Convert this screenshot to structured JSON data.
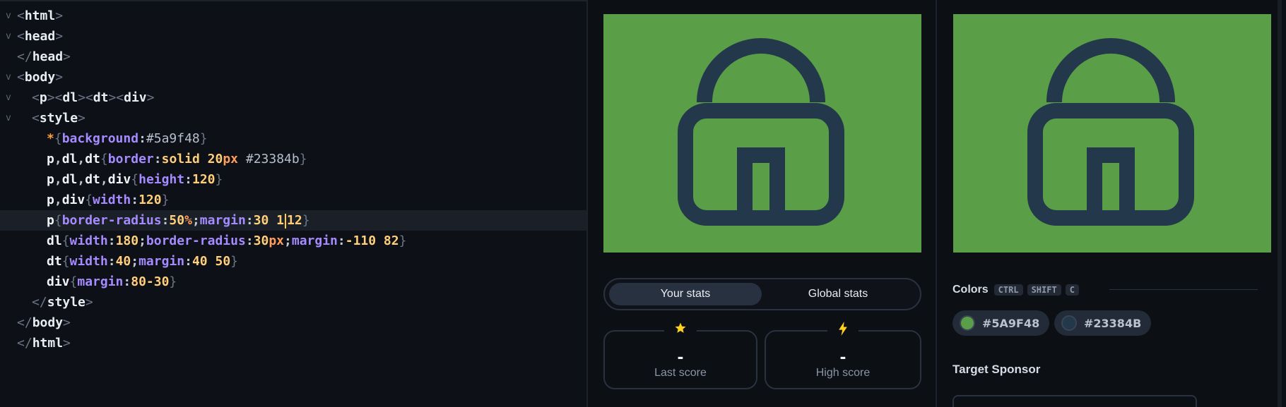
{
  "editor": {
    "lines": [
      {
        "fold": "v",
        "indent": 0,
        "tokens": [
          [
            "br",
            "<"
          ],
          [
            "tag",
            "html"
          ],
          [
            "br",
            ">"
          ]
        ]
      },
      {
        "fold": "v",
        "indent": 0,
        "tokens": [
          [
            "br",
            "<"
          ],
          [
            "tag",
            "head"
          ],
          [
            "br",
            ">"
          ]
        ]
      },
      {
        "fold": "",
        "indent": 0,
        "tokens": [
          [
            "br",
            "</"
          ],
          [
            "tag",
            "head"
          ],
          [
            "br",
            ">"
          ]
        ]
      },
      {
        "fold": "v",
        "indent": 0,
        "tokens": [
          [
            "br",
            "<"
          ],
          [
            "tag",
            "body"
          ],
          [
            "br",
            ">"
          ]
        ]
      },
      {
        "fold": "v",
        "indent": 1,
        "tokens": [
          [
            "br",
            "<"
          ],
          [
            "tag",
            "p"
          ],
          [
            "br",
            "><"
          ],
          [
            "tag",
            "dl"
          ],
          [
            "br",
            "><"
          ],
          [
            "tag",
            "dt"
          ],
          [
            "br",
            "><"
          ],
          [
            "tag",
            "div"
          ],
          [
            "br",
            ">"
          ]
        ]
      },
      {
        "fold": "v",
        "indent": 1,
        "tokens": [
          [
            "br",
            "<"
          ],
          [
            "tag",
            "style"
          ],
          [
            "br",
            ">"
          ]
        ]
      },
      {
        "fold": "",
        "indent": 2,
        "tokens": [
          [
            "star",
            "*"
          ],
          [
            "br",
            "{"
          ],
          [
            "prop",
            "background"
          ],
          [
            "punc",
            ":"
          ],
          [
            "hex",
            "#5a9f48"
          ],
          [
            "br",
            "}"
          ]
        ]
      },
      {
        "fold": "",
        "indent": 2,
        "tokens": [
          [
            "sel",
            "p"
          ],
          [
            "punc",
            ","
          ],
          [
            "sel",
            "dl"
          ],
          [
            "punc",
            ","
          ],
          [
            "sel",
            "dt"
          ],
          [
            "br",
            "{"
          ],
          [
            "prop",
            "border"
          ],
          [
            "punc",
            ":"
          ],
          [
            "kw",
            "solid "
          ],
          [
            "num",
            "20"
          ],
          [
            "unit",
            "px"
          ],
          [
            "hex",
            " #23384b"
          ],
          [
            "br",
            "}"
          ]
        ]
      },
      {
        "fold": "",
        "indent": 2,
        "tokens": [
          [
            "sel",
            "p"
          ],
          [
            "punc",
            ","
          ],
          [
            "sel",
            "dl"
          ],
          [
            "punc",
            ","
          ],
          [
            "sel",
            "dt"
          ],
          [
            "punc",
            ","
          ],
          [
            "sel",
            "div"
          ],
          [
            "br",
            "{"
          ],
          [
            "prop",
            "height"
          ],
          [
            "punc",
            ":"
          ],
          [
            "num",
            "120"
          ],
          [
            "br",
            "}"
          ]
        ]
      },
      {
        "fold": "",
        "indent": 2,
        "tokens": [
          [
            "sel",
            "p"
          ],
          [
            "punc",
            ","
          ],
          [
            "sel",
            "div"
          ],
          [
            "br",
            "{"
          ],
          [
            "prop",
            "width"
          ],
          [
            "punc",
            ":"
          ],
          [
            "num",
            "120"
          ],
          [
            "br",
            "}"
          ]
        ]
      },
      {
        "fold": "",
        "indent": 2,
        "highlight": true,
        "tokens": [
          [
            "sel",
            "p"
          ],
          [
            "br",
            "{"
          ],
          [
            "prop",
            "border-radius"
          ],
          [
            "punc",
            ":"
          ],
          [
            "num",
            "50"
          ],
          [
            "unit",
            "%"
          ],
          [
            "punc",
            ";"
          ],
          [
            "prop",
            "margin"
          ],
          [
            "punc",
            ":"
          ],
          [
            "num",
            "30 1"
          ],
          [
            "cursor",
            ""
          ],
          [
            "num",
            "12"
          ],
          [
            "br",
            "}"
          ]
        ]
      },
      {
        "fold": "",
        "indent": 2,
        "tokens": [
          [
            "sel",
            "dl"
          ],
          [
            "br",
            "{"
          ],
          [
            "prop",
            "width"
          ],
          [
            "punc",
            ":"
          ],
          [
            "num",
            "180"
          ],
          [
            "punc",
            ";"
          ],
          [
            "prop",
            "border-radius"
          ],
          [
            "punc",
            ":"
          ],
          [
            "num",
            "30"
          ],
          [
            "unit",
            "px"
          ],
          [
            "punc",
            ";"
          ],
          [
            "prop",
            "margin"
          ],
          [
            "punc",
            ":"
          ],
          [
            "num",
            "-110 82"
          ],
          [
            "br",
            "}"
          ]
        ]
      },
      {
        "fold": "",
        "indent": 2,
        "tokens": [
          [
            "sel",
            "dt"
          ],
          [
            "br",
            "{"
          ],
          [
            "prop",
            "width"
          ],
          [
            "punc",
            ":"
          ],
          [
            "num",
            "40"
          ],
          [
            "punc",
            ";"
          ],
          [
            "prop",
            "margin"
          ],
          [
            "punc",
            ":"
          ],
          [
            "num",
            "40 50"
          ],
          [
            "br",
            "}"
          ]
        ]
      },
      {
        "fold": "",
        "indent": 2,
        "tokens": [
          [
            "sel",
            "div"
          ],
          [
            "br",
            "{"
          ],
          [
            "prop",
            "margin"
          ],
          [
            "punc",
            ":"
          ],
          [
            "num",
            "80-30"
          ],
          [
            "br",
            "}"
          ]
        ]
      },
      {
        "fold": "",
        "indent": 1,
        "tokens": [
          [
            "br",
            "</"
          ],
          [
            "tag",
            "style"
          ],
          [
            "br",
            ">"
          ]
        ]
      },
      {
        "fold": "",
        "indent": 0,
        "tokens": [
          [
            "br",
            "</"
          ],
          [
            "tag",
            "body"
          ],
          [
            "br",
            ">"
          ]
        ]
      },
      {
        "fold": "",
        "indent": 0,
        "tokens": [
          [
            "br",
            "</"
          ],
          [
            "tag",
            "html"
          ],
          [
            "br",
            ">"
          ]
        ]
      }
    ]
  },
  "preview": {
    "background": "#5a9f48",
    "shape_color": "#23384b"
  },
  "stats": {
    "tabs": [
      "Your stats",
      "Global stats"
    ],
    "active_tab": "Your stats",
    "last_score": {
      "icon": "star-icon",
      "value": "-",
      "label": "Last score"
    },
    "high_score": {
      "icon": "lightning-icon",
      "value": "-",
      "label": "High score"
    }
  },
  "colors": {
    "title": "Colors",
    "shortcut": [
      "CTRL",
      "SHIFT",
      "C"
    ],
    "swatches": [
      {
        "hex": "#5A9F48",
        "color": "#5a9f48"
      },
      {
        "hex": "#23384B",
        "color": "#23384b"
      }
    ]
  },
  "sponsor": {
    "title": "Target Sponsor"
  }
}
